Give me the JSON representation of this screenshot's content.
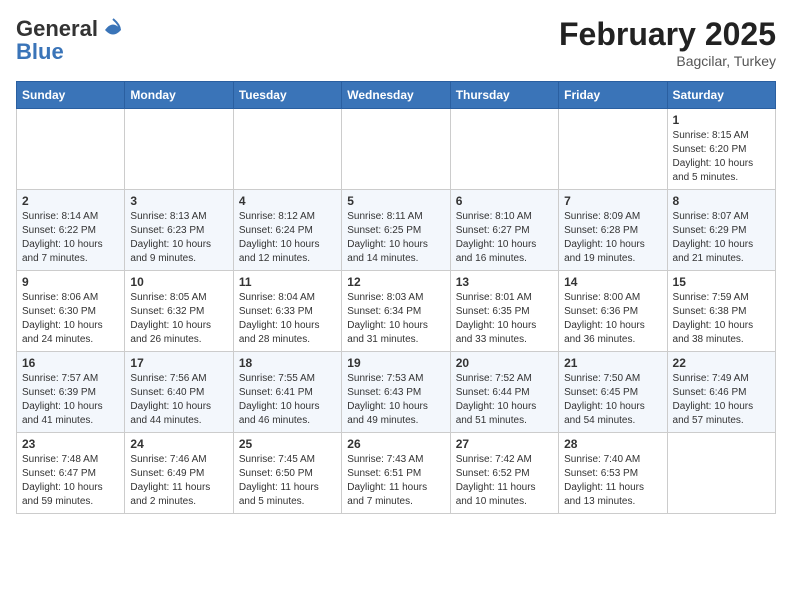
{
  "header": {
    "logo_line1": "General",
    "logo_line2": "Blue",
    "month_year": "February 2025",
    "location": "Bagcilar, Turkey"
  },
  "days_of_week": [
    "Sunday",
    "Monday",
    "Tuesday",
    "Wednesday",
    "Thursday",
    "Friday",
    "Saturday"
  ],
  "weeks": [
    [
      {
        "day": "",
        "info": ""
      },
      {
        "day": "",
        "info": ""
      },
      {
        "day": "",
        "info": ""
      },
      {
        "day": "",
        "info": ""
      },
      {
        "day": "",
        "info": ""
      },
      {
        "day": "",
        "info": ""
      },
      {
        "day": "1",
        "info": "Sunrise: 8:15 AM\nSunset: 6:20 PM\nDaylight: 10 hours\nand 5 minutes."
      }
    ],
    [
      {
        "day": "2",
        "info": "Sunrise: 8:14 AM\nSunset: 6:22 PM\nDaylight: 10 hours\nand 7 minutes."
      },
      {
        "day": "3",
        "info": "Sunrise: 8:13 AM\nSunset: 6:23 PM\nDaylight: 10 hours\nand 9 minutes."
      },
      {
        "day": "4",
        "info": "Sunrise: 8:12 AM\nSunset: 6:24 PM\nDaylight: 10 hours\nand 12 minutes."
      },
      {
        "day": "5",
        "info": "Sunrise: 8:11 AM\nSunset: 6:25 PM\nDaylight: 10 hours\nand 14 minutes."
      },
      {
        "day": "6",
        "info": "Sunrise: 8:10 AM\nSunset: 6:27 PM\nDaylight: 10 hours\nand 16 minutes."
      },
      {
        "day": "7",
        "info": "Sunrise: 8:09 AM\nSunset: 6:28 PM\nDaylight: 10 hours\nand 19 minutes."
      },
      {
        "day": "8",
        "info": "Sunrise: 8:07 AM\nSunset: 6:29 PM\nDaylight: 10 hours\nand 21 minutes."
      }
    ],
    [
      {
        "day": "9",
        "info": "Sunrise: 8:06 AM\nSunset: 6:30 PM\nDaylight: 10 hours\nand 24 minutes."
      },
      {
        "day": "10",
        "info": "Sunrise: 8:05 AM\nSunset: 6:32 PM\nDaylight: 10 hours\nand 26 minutes."
      },
      {
        "day": "11",
        "info": "Sunrise: 8:04 AM\nSunset: 6:33 PM\nDaylight: 10 hours\nand 28 minutes."
      },
      {
        "day": "12",
        "info": "Sunrise: 8:03 AM\nSunset: 6:34 PM\nDaylight: 10 hours\nand 31 minutes."
      },
      {
        "day": "13",
        "info": "Sunrise: 8:01 AM\nSunset: 6:35 PM\nDaylight: 10 hours\nand 33 minutes."
      },
      {
        "day": "14",
        "info": "Sunrise: 8:00 AM\nSunset: 6:36 PM\nDaylight: 10 hours\nand 36 minutes."
      },
      {
        "day": "15",
        "info": "Sunrise: 7:59 AM\nSunset: 6:38 PM\nDaylight: 10 hours\nand 38 minutes."
      }
    ],
    [
      {
        "day": "16",
        "info": "Sunrise: 7:57 AM\nSunset: 6:39 PM\nDaylight: 10 hours\nand 41 minutes."
      },
      {
        "day": "17",
        "info": "Sunrise: 7:56 AM\nSunset: 6:40 PM\nDaylight: 10 hours\nand 44 minutes."
      },
      {
        "day": "18",
        "info": "Sunrise: 7:55 AM\nSunset: 6:41 PM\nDaylight: 10 hours\nand 46 minutes."
      },
      {
        "day": "19",
        "info": "Sunrise: 7:53 AM\nSunset: 6:43 PM\nDaylight: 10 hours\nand 49 minutes."
      },
      {
        "day": "20",
        "info": "Sunrise: 7:52 AM\nSunset: 6:44 PM\nDaylight: 10 hours\nand 51 minutes."
      },
      {
        "day": "21",
        "info": "Sunrise: 7:50 AM\nSunset: 6:45 PM\nDaylight: 10 hours\nand 54 minutes."
      },
      {
        "day": "22",
        "info": "Sunrise: 7:49 AM\nSunset: 6:46 PM\nDaylight: 10 hours\nand 57 minutes."
      }
    ],
    [
      {
        "day": "23",
        "info": "Sunrise: 7:48 AM\nSunset: 6:47 PM\nDaylight: 10 hours\nand 59 minutes."
      },
      {
        "day": "24",
        "info": "Sunrise: 7:46 AM\nSunset: 6:49 PM\nDaylight: 11 hours\nand 2 minutes."
      },
      {
        "day": "25",
        "info": "Sunrise: 7:45 AM\nSunset: 6:50 PM\nDaylight: 11 hours\nand 5 minutes."
      },
      {
        "day": "26",
        "info": "Sunrise: 7:43 AM\nSunset: 6:51 PM\nDaylight: 11 hours\nand 7 minutes."
      },
      {
        "day": "27",
        "info": "Sunrise: 7:42 AM\nSunset: 6:52 PM\nDaylight: 11 hours\nand 10 minutes."
      },
      {
        "day": "28",
        "info": "Sunrise: 7:40 AM\nSunset: 6:53 PM\nDaylight: 11 hours\nand 13 minutes."
      },
      {
        "day": "",
        "info": ""
      }
    ]
  ]
}
